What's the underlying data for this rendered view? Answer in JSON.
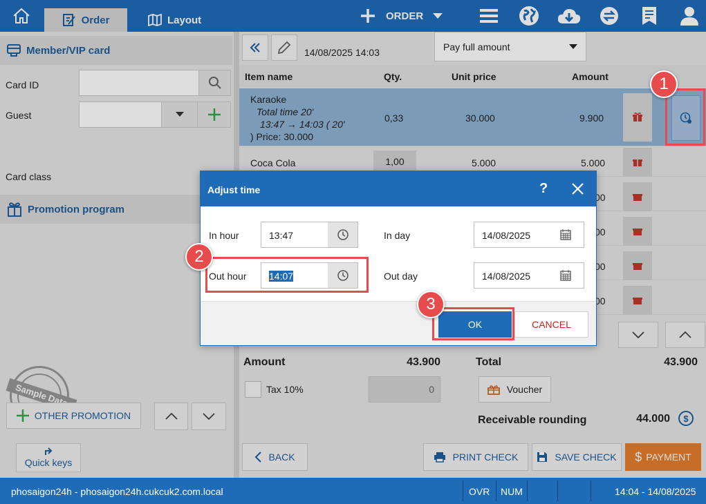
{
  "topbar": {
    "tab_order": "Order",
    "tab_layout": "Layout",
    "order_menu": "ORDER"
  },
  "left": {
    "member_title": "Member/VIP card",
    "card_id_label": "Card ID",
    "guest_label": "Guest",
    "card_class_label": "Card class",
    "promotion_title": "Promotion program",
    "stamp_text": "Sample Data",
    "other_promotion": "OTHER PROMOTION",
    "quick_keys": "Quick keys"
  },
  "order": {
    "datetime": "14/08/2025 14:03",
    "pay_option": "Pay full amount",
    "columns": {
      "item": "Item name",
      "qty": "Qty.",
      "unit_price": "Unit price",
      "amount": "Amount"
    },
    "karaoke": {
      "name": "Karaoke",
      "line1": "Total time 20'",
      "line2": "13:47 → 14:03 ( 20'",
      "line3": ") Price: 30.000",
      "qty": "0,33",
      "unit_price": "30.000",
      "amount": "9.900"
    },
    "coca": {
      "name": "Coca Cola",
      "qty": "1,00",
      "unit_price": "5.000",
      "amount": "5.000"
    },
    "hidden_amounts": [
      "00",
      "00",
      "00",
      "00"
    ]
  },
  "summary": {
    "amount_label": "Amount",
    "amount_value": "43.900",
    "total_label": "Total",
    "total_value": "43.900",
    "tax_label": "Tax 10%",
    "tax_value": "0",
    "voucher": "Voucher",
    "rounding_label": "Receivable rounding",
    "rounding_value": "44.000"
  },
  "actions": {
    "back": "BACK",
    "print_check": "PRINT CHECK",
    "save_check": "SAVE CHECK",
    "payment": "PAYMENT"
  },
  "status": {
    "host": "phosaigon24h - phosaigon24h.cukcuk2.com.local",
    "ovr": "OVR",
    "num": "NUM",
    "time": "14:04 - 14/08/2025"
  },
  "dialog": {
    "title": "Adjust time",
    "help": "?",
    "in_hour_label": "In hour",
    "in_hour": "13:47",
    "in_day_label": "In day",
    "in_day": "14/08/2025",
    "out_hour_label": "Out hour",
    "out_hour": "14:07",
    "out_day_label": "Out day",
    "out_day": "14/08/2025",
    "ok": "OK",
    "cancel": "CANCEL"
  },
  "steps": [
    "1",
    "2",
    "3"
  ],
  "colors": {
    "brand_blue": "#1e6bb8",
    "selected_row": "#8fb3d4",
    "payment_orange": "#e47e2d",
    "annotation_red": "#e84b4b",
    "cancel_red": "#cc1f1f"
  }
}
